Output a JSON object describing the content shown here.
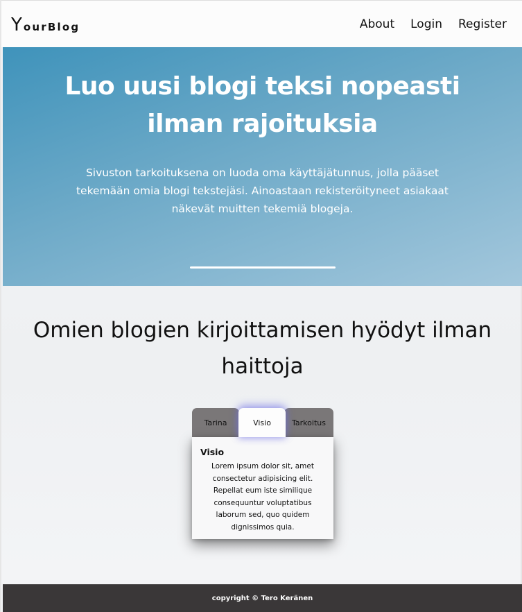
{
  "header": {
    "logo_initial": "Y",
    "logo_rest": "ourBlog",
    "nav": [
      "About",
      "Login",
      "Register"
    ]
  },
  "hero": {
    "title": "Luo uusi blogi teksi nopeasti ilman rajoituksia",
    "description": "Sivuston tarkoituksena on luoda oma käyttäjätunnus, jolla pääset tekemään omia blogi tekstejäsi. Ainoastaan rekisteröityneet asiakaat näkevät muitten tekemiä blogeja."
  },
  "section": {
    "title": "Omien blogien kirjoittamisen hyödyt ilman haittoja"
  },
  "tabs": {
    "items": [
      "Tarina",
      "Visio",
      "Tarkoitus"
    ],
    "active": "Visio",
    "panel_title": "Visio",
    "panel_text": "Lorem ipsum dolor sit, amet consectetur adipisicing elit. Repellat eum iste similique consequuntur voluptatibus laborum sed, quo quidem dignissimos quia."
  },
  "footer": {
    "text": "copyright © Tero Keränen"
  },
  "colors": {
    "hero_gradient_start": "#3f93bb",
    "hero_gradient_end": "#a3c7dc",
    "tab_inactive": "#7a7778",
    "footer_bg": "#3a3738"
  }
}
